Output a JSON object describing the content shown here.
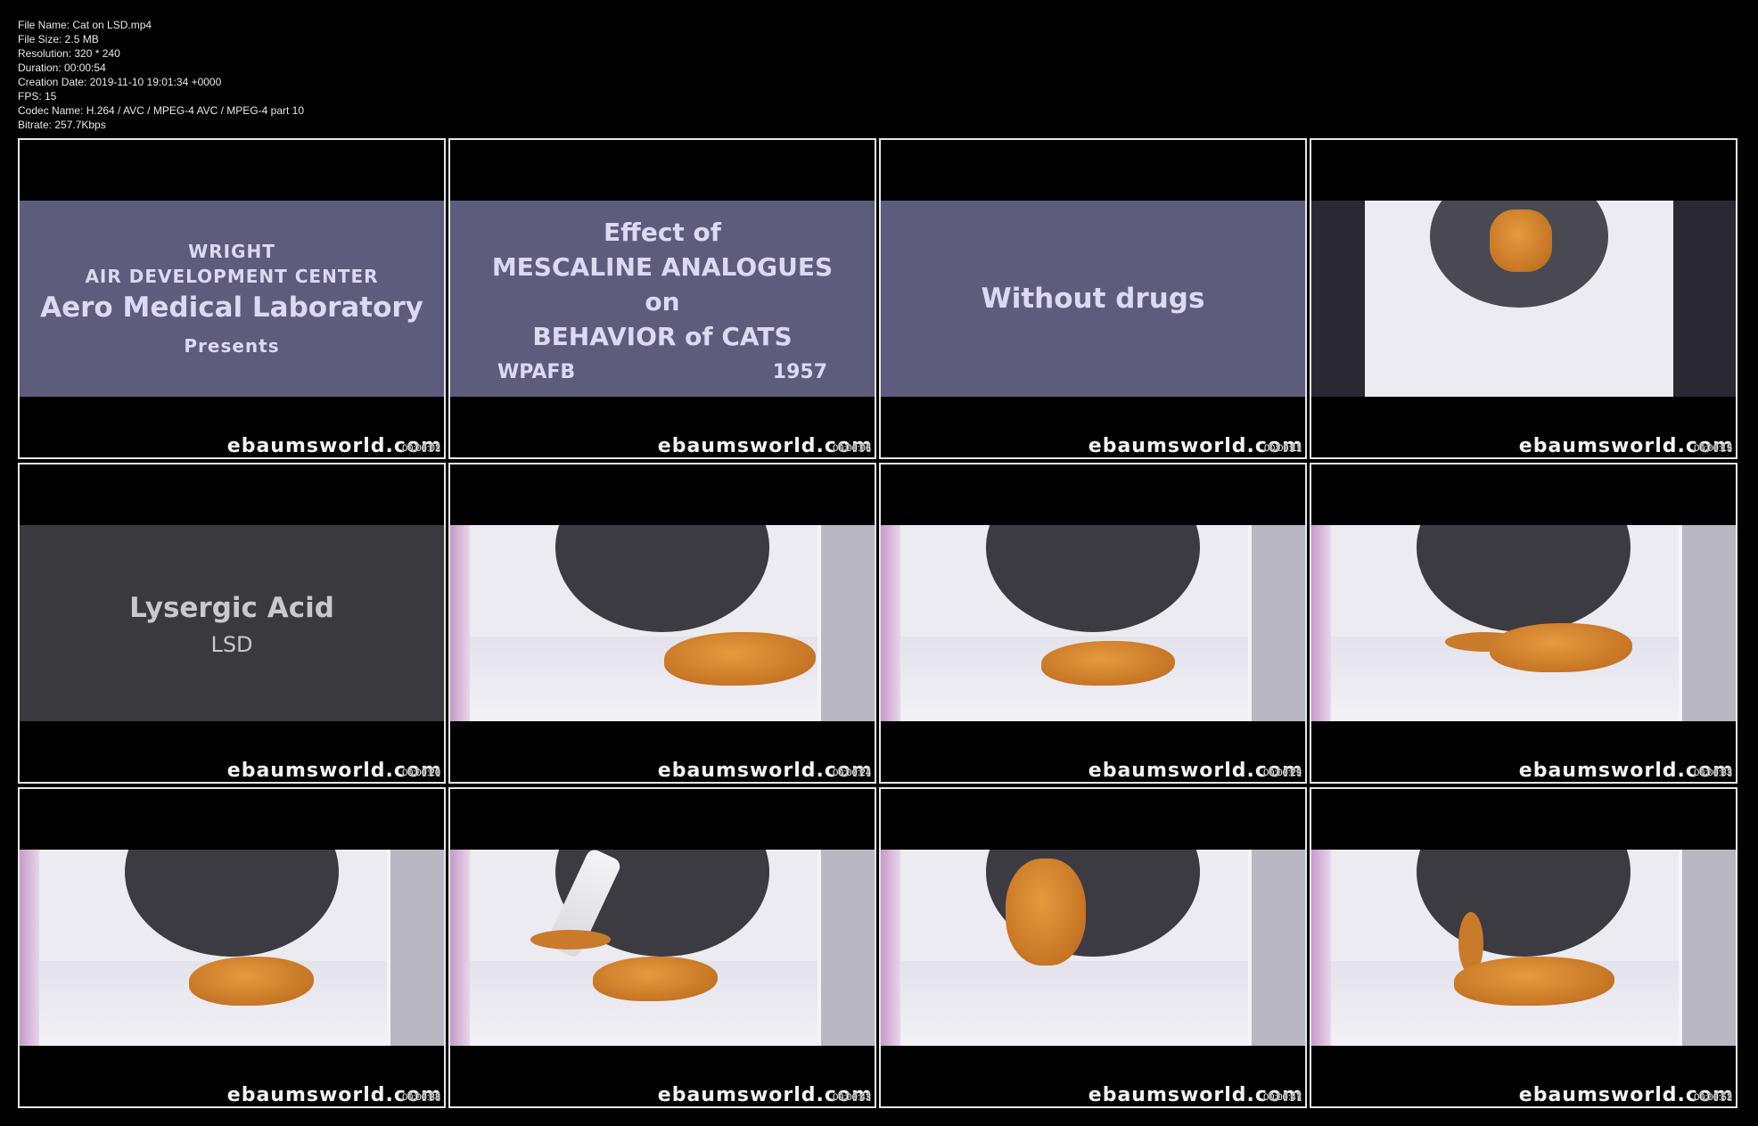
{
  "file_info": {
    "file_name": "File Name: Cat on LSD.mp4",
    "file_size": "File Size: 2.5 MB",
    "resolution": "Resolution: 320 * 240",
    "duration": "Duration: 00:00:54",
    "creation_date": "Creation Date: 2019-11-10 19:01:34 +0000",
    "fps": "FPS: 15",
    "codec": "Codec Name: H.264 / AVC / MPEG-4 AVC / MPEG-4 part 10",
    "bitrate": "Bitrate: 257.7Kbps"
  },
  "watermark": "ebaumsworld.com",
  "frames": [
    {
      "timestamp": "00:00:02",
      "kind": "title-card",
      "lines": {
        "l1": "WRIGHT",
        "l2": "AIR DEVELOPMENT CENTER",
        "l3": "Aero Medical Laboratory",
        "l4": "Presents"
      }
    },
    {
      "timestamp": "00:00:06",
      "kind": "title-card",
      "lines": {
        "l1": "Effect of",
        "l2": "MESCALINE ANALOGUES",
        "l3": "on",
        "l4": "BEHAVIOR of CATS",
        "l5a": "WPAFB",
        "l5b": "1957"
      }
    },
    {
      "timestamp": "00:00:11",
      "kind": "title-card",
      "lines": {
        "l1": "Without drugs"
      }
    },
    {
      "timestamp": "00:00:15",
      "kind": "scene",
      "description_icon": "cat-jumping-icon"
    },
    {
      "timestamp": "00:00:20",
      "kind": "title-card",
      "lines": {
        "l1": "Lysergic Acid",
        "l2": "LSD"
      }
    },
    {
      "timestamp": "00:00:24",
      "kind": "scene",
      "description_icon": "cat-icon"
    },
    {
      "timestamp": "00:00:29",
      "kind": "scene",
      "description_icon": "cat-icon"
    },
    {
      "timestamp": "00:00:33",
      "kind": "scene",
      "description_icon": "cat-icon"
    },
    {
      "timestamp": "00:00:38",
      "kind": "scene",
      "description_icon": "cat-icon"
    },
    {
      "timestamp": "00:00:43",
      "kind": "scene",
      "description_icon": "cat-icon"
    },
    {
      "timestamp": "00:00:47",
      "kind": "scene",
      "description_icon": "cat-icon"
    },
    {
      "timestamp": "00:00:52",
      "kind": "scene",
      "description_icon": "cat-icon"
    }
  ],
  "colors": {
    "background": "#000000",
    "card_blue": "#5d5c7c",
    "card_gray": "#3a3a3e",
    "card_text": "#dcd9f2",
    "thumb_border": "#e6e6e6",
    "cat_orange": "#d98a30"
  }
}
